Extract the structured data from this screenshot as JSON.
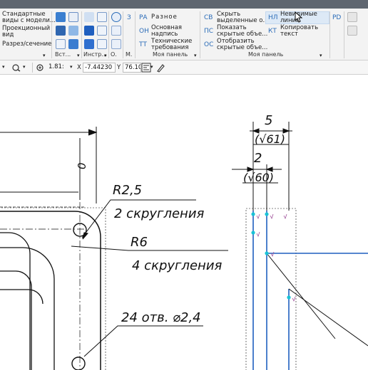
{
  "ribbon": {
    "views": {
      "std_views": "Стандартные\nвиды с модели...",
      "proj_view": "Проекционный\nвид",
      "section": "Разрез/сечение"
    },
    "footers": {
      "views": "Вст...",
      "tools": "Инстр...",
      "o": "О.",
      "m": "М.",
      "panel1": "Моя панель",
      "panel2": "Моя панель"
    },
    "panel1": {
      "z_abbr": "З",
      "ra_abbr": "РА",
      "ra_label": "Разное",
      "on_abbr": "ОН",
      "on_label": "Основная\nнадпись",
      "tt_abbr": "ТТ",
      "tt_label": "Технические\nтребования"
    },
    "panel2": {
      "sv_abbr": "СВ",
      "sv_label": "Скрыть\nвыделенные о...",
      "ps_abbr": "ПС",
      "ps_label": "Показать\nскрытые объе...",
      "os_abbr": "ОС",
      "os_label": "Отобразить\nскрытые объе...",
      "nl_abbr": "НЛ",
      "nl_label": "Невидимые\nлинии",
      "kt_abbr": "КТ",
      "kt_label": "Копировать\nтекст",
      "pd_abbr": "PD"
    }
  },
  "toolbar": {
    "zoom": "1.81:",
    "x_label": "X",
    "x_value": "-7.44230",
    "y_label": "Y",
    "y_value": "76.10434"
  },
  "drawing": {
    "dim_zero": "0",
    "radius_small": "R2,5",
    "fillets_2": "2 скругления",
    "radius_big": "R6",
    "fillets_4": "4 скругления",
    "holes": "24 отв. ⌀2,4",
    "dim_5": "5",
    "rough_61": "(√61)",
    "dim_2": "2",
    "rough_60": "(√60)"
  },
  "colors": {
    "accent": "#2b6cb8",
    "cad_line": "#111111",
    "cad_blue": "#1f5fbf",
    "cad_cyan": "#19c3d6"
  }
}
